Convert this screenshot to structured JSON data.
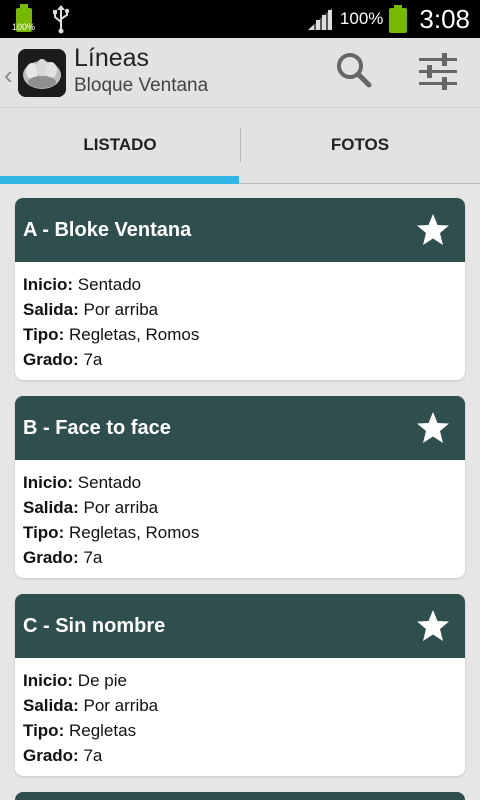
{
  "status_bar": {
    "small_battery_percent": "100%",
    "battery_percent": "100%",
    "time": "3:08"
  },
  "action_bar": {
    "title": "Líneas",
    "subtitle": "Bloque Ventana",
    "up_caret": "‹"
  },
  "tabs": [
    {
      "label": "LISTADO",
      "selected": true
    },
    {
      "label": "FOTOS",
      "selected": false
    }
  ],
  "routes": [
    {
      "title": "A - Bloke Ventana",
      "inicio_label": "Inicio:",
      "inicio": "Sentado",
      "salida_label": "Salida:",
      "salida": "Por arriba",
      "tipo_label": "Tipo:",
      "tipo": "Regletas, Romos",
      "grado_label": "Grado:",
      "grado": "7a"
    },
    {
      "title": "B - Face to face",
      "inicio_label": "Inicio:",
      "inicio": "Sentado",
      "salida_label": "Salida:",
      "salida": "Por arriba",
      "tipo_label": "Tipo:",
      "tipo": "Regletas, Romos",
      "grado_label": "Grado:",
      "grado": "7a"
    },
    {
      "title": "C - Sin nombre",
      "inicio_label": "Inicio:",
      "inicio": "De pie",
      "salida_label": "Salida:",
      "salida": "Por arriba",
      "tipo_label": "Tipo:",
      "tipo": "Regletas",
      "grado_label": "Grado:",
      "grado": "7a"
    }
  ],
  "colors": {
    "card_header": "#2f4f4f",
    "tab_indicator": "#33b5e5",
    "battery": "#76b900"
  },
  "icons": [
    "usb-icon",
    "signal-icon",
    "battery-icon",
    "search-icon",
    "filter-sliders-icon",
    "star-icon"
  ]
}
